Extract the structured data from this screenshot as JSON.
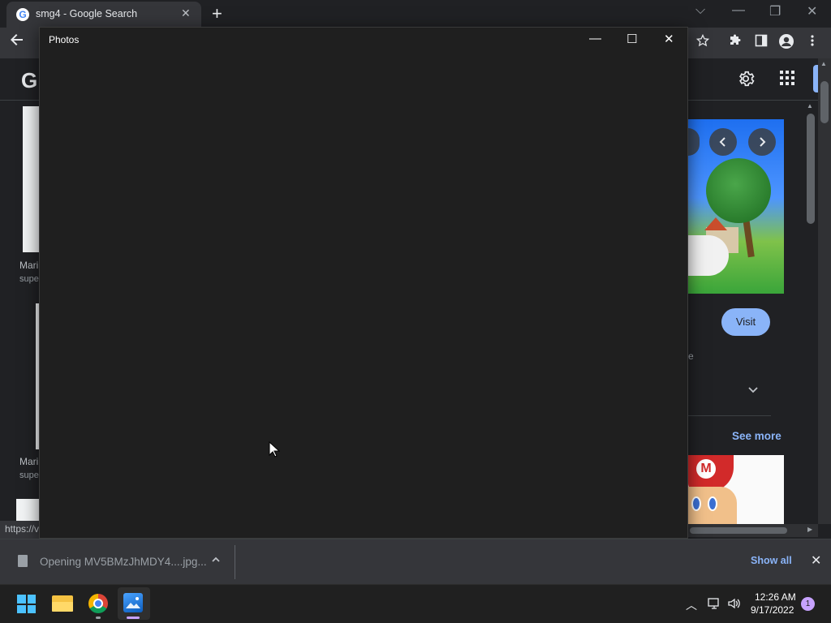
{
  "browser": {
    "tab_title": "smg4 - Google Search",
    "tab_close": "✕",
    "new_tab": "+",
    "favicon": "G",
    "window_controls": {
      "chevron": "⌵",
      "minimize": "—",
      "restore": "❐",
      "close": "✕"
    },
    "toolbar_icons": [
      "back-arrow-icon",
      "star-icon",
      "puzzle-icon",
      "sidebar-icon",
      "profile-icon",
      "kebab-menu-icon"
    ]
  },
  "google": {
    "logo": "G",
    "results_left": [
      {
        "title": "Mari",
        "source": "supe"
      },
      {
        "title": "Mari",
        "source": "supe"
      }
    ],
    "panel": {
      "visit_label": "Visit",
      "partial_text": "e",
      "see_more": "See more"
    }
  },
  "status_bar": {
    "url": "https://v"
  },
  "photos_window": {
    "title": "Photos",
    "minimize": "—",
    "maximize": "☐",
    "close": "✕"
  },
  "downloads": {
    "item_text": "Opening MV5BMzJhMDY4....jpg...",
    "show_all": "Show all",
    "close": "✕"
  },
  "taskbar": {
    "time": "12:26 AM",
    "date": "9/17/2022",
    "notification_count": "1",
    "tray_chevron": "︿"
  },
  "colors": {
    "accent_blue": "#8ab4f8",
    "photos_bg": "#1f1f1f",
    "taskbar_bg": "#202020"
  }
}
